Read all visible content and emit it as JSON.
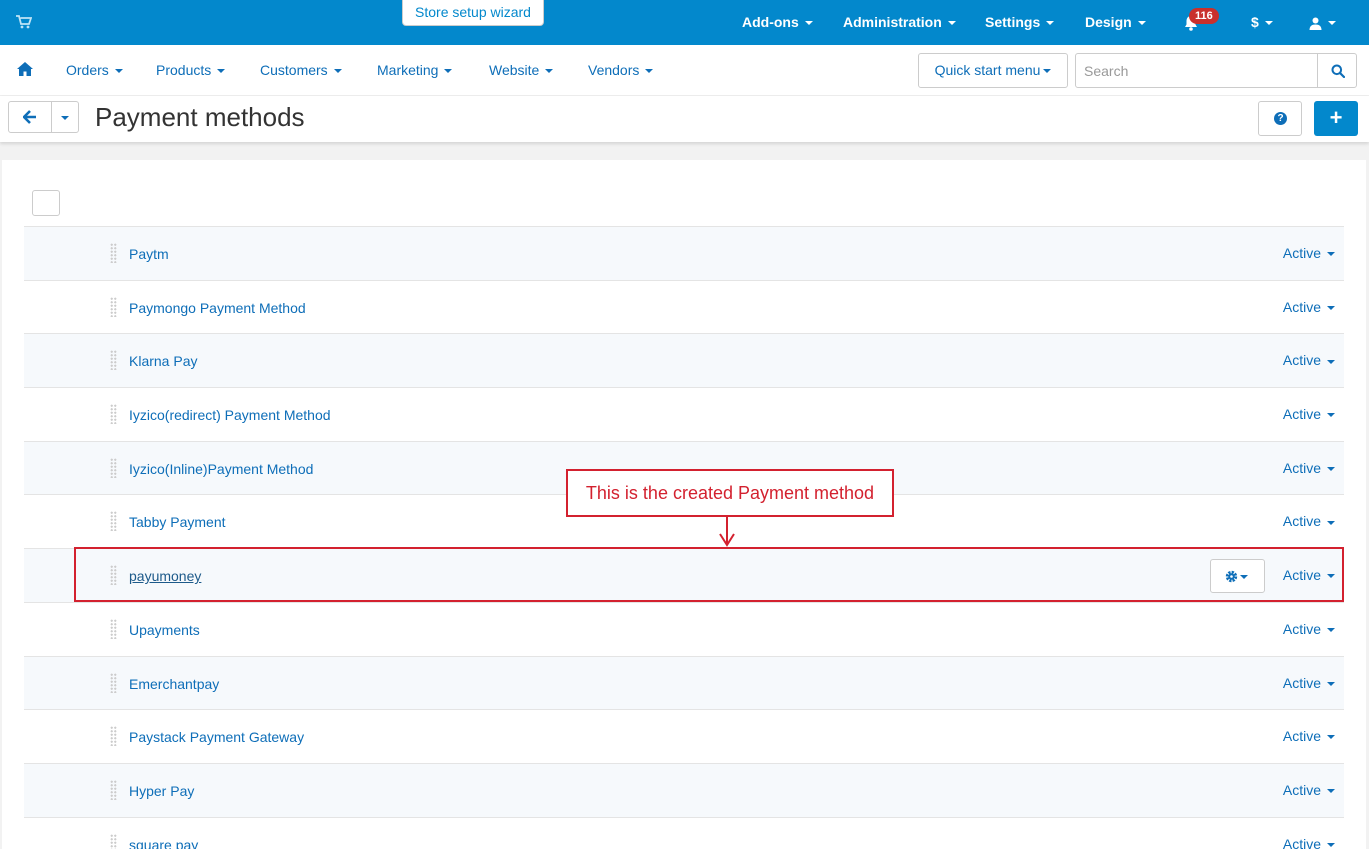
{
  "topbar": {
    "wizard_label": "Store setup wizard",
    "menus": [
      "Add-ons",
      "Administration",
      "Settings",
      "Design"
    ],
    "notifications_count": "116",
    "currency_label": "$",
    "brand_color": "#0388cc",
    "icons": [
      "cart-icon",
      "bell-icon",
      "user-icon"
    ]
  },
  "subnav": {
    "items": [
      "Orders",
      "Products",
      "Customers",
      "Marketing",
      "Website",
      "Vendors"
    ],
    "quick_start_label": "Quick start menu",
    "search_placeholder": "Search",
    "icons": [
      "home-icon",
      "search-icon"
    ]
  },
  "titlebar": {
    "title": "Payment methods",
    "help_label": "?",
    "add_label": "+",
    "icons": [
      "arrow-left-icon",
      "help-icon",
      "plus-icon"
    ]
  },
  "payment_methods": [
    {
      "name": "Paytm",
      "status": "Active"
    },
    {
      "name": "Paymongo Payment Method",
      "status": "Active"
    },
    {
      "name": "Klarna Pay",
      "status": "Active"
    },
    {
      "name": "Iyzico(redirect) Payment Method",
      "status": "Active"
    },
    {
      "name": "Iyzico(Inline)Payment Method",
      "status": "Active"
    },
    {
      "name": "Tabby Payment",
      "status": "Active"
    },
    {
      "name": "payumoney",
      "status": "Active",
      "hovered": true
    },
    {
      "name": "Upayments",
      "status": "Active"
    },
    {
      "name": "Emerchantpay",
      "status": "Active"
    },
    {
      "name": "Paystack Payment Gateway",
      "status": "Active"
    },
    {
      "name": "Hyper Pay",
      "status": "Active"
    },
    {
      "name": "square pay",
      "status": "Active"
    }
  ],
  "annotation": {
    "text": "This is the created Payment method",
    "color": "#d3212f"
  }
}
